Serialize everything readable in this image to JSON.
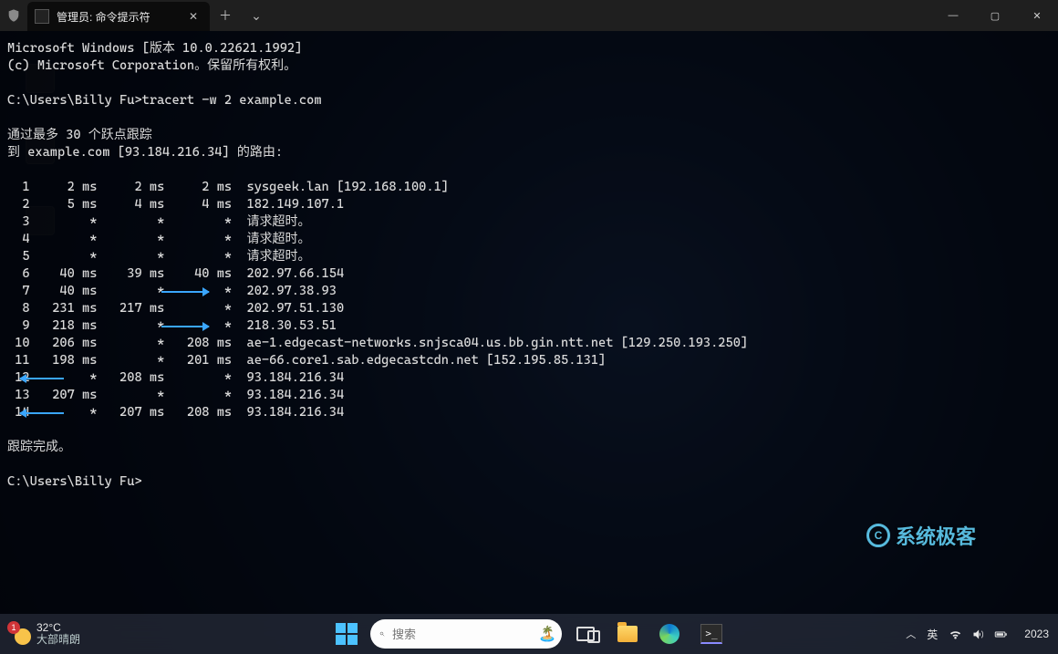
{
  "titlebar": {
    "tab_title": "管理员: 命令提示符",
    "close_glyph": "✕",
    "newtab_glyph": "＋",
    "dropdown_glyph": "⌄",
    "min_glyph": "—",
    "max_glyph": "▢",
    "winclose_glyph": "✕"
  },
  "terminal": {
    "banner_line1": "Microsoft Windows [版本 10.0.22621.1992]",
    "banner_line2": "(c) Microsoft Corporation。保留所有权利。",
    "prompt_path": "C:\\Users\\Billy Fu>",
    "command": "tracert -w 2 example.com",
    "trace_header_line1": "通过最多 30 个跃点跟踪",
    "trace_header_line2": "到 example.com [93.184.216.34] 的路由:",
    "hops": [
      {
        "n": 1,
        "t1": "2 ms",
        "t2": "2 ms",
        "t3": "2 ms",
        "host": "sysgeek.lan [192.168.100.1]"
      },
      {
        "n": 2,
        "t1": "5 ms",
        "t2": "4 ms",
        "t3": "4 ms",
        "host": "182.149.107.1"
      },
      {
        "n": 3,
        "t1": "*",
        "t2": "*",
        "t3": "*",
        "host": "请求超时。"
      },
      {
        "n": 4,
        "t1": "*",
        "t2": "*",
        "t3": "*",
        "host": "请求超时。"
      },
      {
        "n": 5,
        "t1": "*",
        "t2": "*",
        "t3": "*",
        "host": "请求超时。"
      },
      {
        "n": 6,
        "t1": "40 ms",
        "t2": "39 ms",
        "t3": "40 ms",
        "host": "202.97.66.154"
      },
      {
        "n": 7,
        "t1": "40 ms",
        "t2": "*",
        "t3": "*",
        "host": "202.97.38.93"
      },
      {
        "n": 8,
        "t1": "231 ms",
        "t2": "217 ms",
        "t3": "*",
        "host": "202.97.51.130"
      },
      {
        "n": 9,
        "t1": "218 ms",
        "t2": "*",
        "t3": "*",
        "host": "218.30.53.51"
      },
      {
        "n": 10,
        "t1": "206 ms",
        "t2": "*",
        "t3": "208 ms",
        "host": "ae-1.edgecast-networks.snjsca04.us.bb.gin.ntt.net [129.250.193.250]"
      },
      {
        "n": 11,
        "t1": "198 ms",
        "t2": "*",
        "t3": "201 ms",
        "host": "ae-66.core1.sab.edgecastcdn.net [152.195.85.131]"
      },
      {
        "n": 12,
        "t1": "*",
        "t2": "208 ms",
        "t3": "*",
        "host": "93.184.216.34"
      },
      {
        "n": 13,
        "t1": "207 ms",
        "t2": "*",
        "t3": "*",
        "host": "93.184.216.34"
      },
      {
        "n": 14,
        "t1": "*",
        "t2": "207 ms",
        "t3": "208 ms",
        "host": "93.184.216.34"
      }
    ],
    "complete": "跟踪完成。",
    "final_prompt": "C:\\Users\\Billy Fu>"
  },
  "watermark": {
    "text": "系统极客"
  },
  "taskbar": {
    "weather_badge": "1",
    "weather_temp": "32°C",
    "weather_desc": "大部晴朗",
    "search_placeholder": "搜索",
    "ime": "英",
    "clock": "2023"
  }
}
